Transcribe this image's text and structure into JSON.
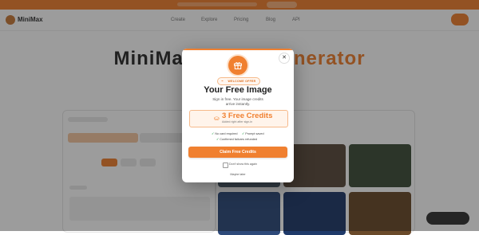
{
  "brand": {
    "logo_text": "MiniMax",
    "accent_color": "#f08030"
  },
  "nav": {
    "items": [
      "Create",
      "Explore",
      "Pricing",
      "Blog",
      "API"
    ]
  },
  "hero": {
    "title_main": "MiniMax",
    "title_accent": "Image Generator"
  },
  "modal": {
    "badge": "WELCOME OFFER",
    "title": "Your Free Image",
    "subtitle": "Sign in free. Your image credits arrive instantly.",
    "credits_main": "3 Free Credits",
    "credits_note": "Added right after sign-in",
    "features": [
      "No card required",
      "Prompt saved",
      "Confirmed failures refunded"
    ],
    "claim_label": "Claim Free Credits",
    "dont_show_label": "Don't show this again",
    "maybe_later_label": "Maybe later",
    "close_glyph": "✕",
    "icons": {
      "gift": "gift-icon",
      "badge": "tag-icon",
      "credits": "coins-icon",
      "check": "check-icon",
      "close": "close-icon"
    }
  }
}
